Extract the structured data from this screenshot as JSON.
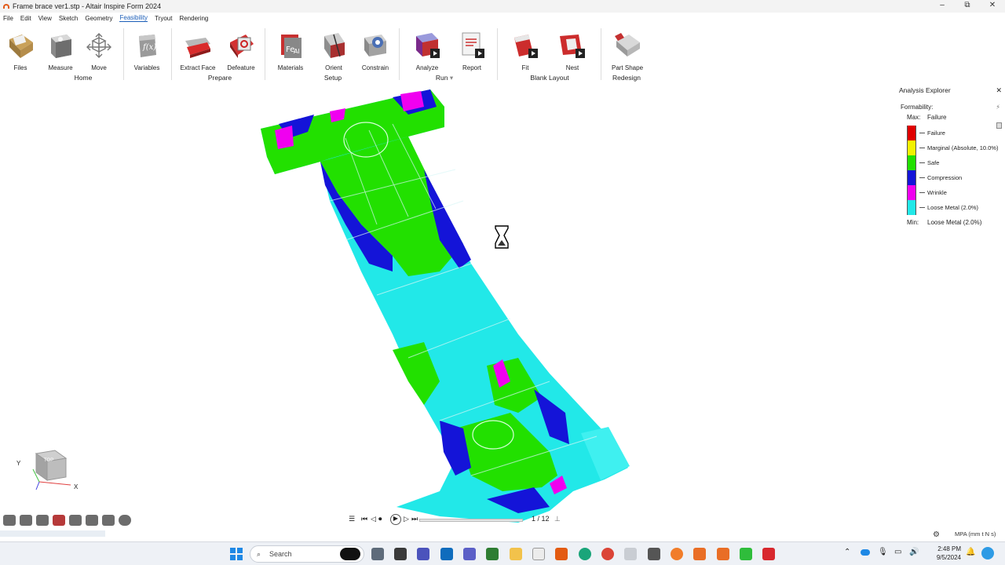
{
  "window": {
    "title": "Frame brace ver1.stp - Altair Inspire Form 2024",
    "minimize": "–",
    "maximize": "⧉",
    "close": "✕"
  },
  "menu": {
    "items": [
      "File",
      "Edit",
      "View",
      "Sketch",
      "Geometry",
      "Feasibility",
      "Tryout",
      "Rendering"
    ],
    "active": "Feasibility"
  },
  "ribbon": {
    "tools": {
      "files": "Files",
      "measure": "Measure",
      "move": "Move",
      "variables": "Variables",
      "extract_face": "Extract Face",
      "defeature": "Defeature",
      "materials": "Materials",
      "orient": "Orient",
      "constrain": "Constrain",
      "analyze": "Analyze",
      "report": "Report",
      "fit": "Fit",
      "nest": "Nest",
      "part_shape": "Part Shape"
    },
    "groups": {
      "home": "Home",
      "prepare": "Prepare",
      "setup": "Setup",
      "run": "Run",
      "blank_layout": "Blank Layout",
      "redesign": "Redesign"
    }
  },
  "analysis_explorer": {
    "title": "Analysis Explorer",
    "close": "✕",
    "result_label": "Formability:",
    "max_label": "Max:",
    "max_value": "Failure",
    "min_label": "Min:",
    "min_value": "Loose Metal (2.0%)",
    "legend": [
      {
        "label": "Failure",
        "color": "#e00000"
      },
      {
        "label": "Marginal (Absolute, 10.0%)",
        "color": "#f2f200"
      },
      {
        "label": "Safe",
        "color": "#22e000"
      },
      {
        "label": "Compression",
        "color": "#1414d8"
      },
      {
        "label": "Wrinkle",
        "color": "#f000f0"
      },
      {
        "label": "Loose Metal (2.0%)",
        "color": "#22e8e8"
      }
    ]
  },
  "playback": {
    "frame": "1 / 12",
    "progress": 0
  },
  "view_cube": {
    "face": "TOP",
    "axis_y": "Y",
    "axis_x": "X"
  },
  "status": {
    "units": "MPA (mm t N s)"
  },
  "taskbar": {
    "search_placeholder": "Search",
    "time": "2:48 PM",
    "date": "9/5/2024"
  },
  "colors": {
    "failure": "#e00000",
    "marginal": "#f2f200",
    "safe": "#22e000",
    "compression": "#1414d8",
    "wrinkle": "#f000f0",
    "loose": "#22e8e8",
    "accent": "#1d5fb8"
  }
}
